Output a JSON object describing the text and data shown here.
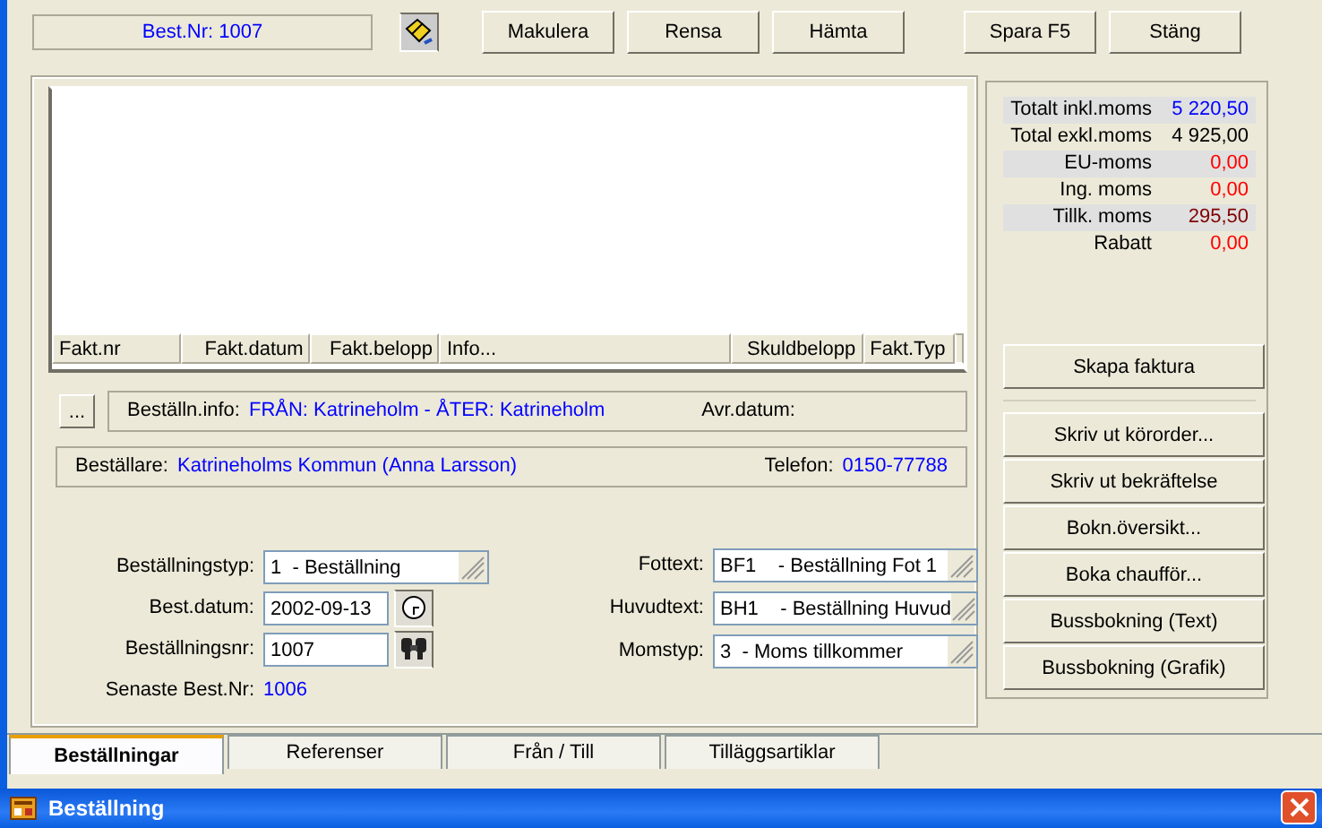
{
  "window": {
    "title": "Beställning"
  },
  "tabs": [
    {
      "label": "Beställningar",
      "selected": true
    },
    {
      "label": "Referenser",
      "selected": false
    },
    {
      "label": "Från / Till",
      "selected": false
    },
    {
      "label": "Tilläggsartiklar",
      "selected": false
    }
  ],
  "toolbar": {
    "order_number": "Best.Nr: 1007",
    "buttons": [
      "Makulera",
      "Rensa",
      "Hämta",
      "Spara F5",
      "Stäng"
    ]
  },
  "invoice_table": {
    "columns": [
      "Fakt.nr",
      "Fakt.datum",
      "Fakt.belopp",
      "Info...",
      "Skuldbelopp",
      "Fakt.Typ"
    ]
  },
  "order_info": {
    "button": "...",
    "label": "Beställn.info:",
    "value": "FRÅN: Katrineholm - ÅTER: Katrineholm",
    "return_date_label": "Avr.datum:"
  },
  "customer": {
    "label": "Beställare:",
    "value": "Katrineholms Kommun (Anna Larsson)",
    "phone_label": "Telefon:",
    "phone": "0150-77788"
  },
  "latest_order": {
    "label": "Senaste Best.Nr:",
    "value": "1006"
  },
  "fields_left": [
    {
      "label": "Beställningstyp:",
      "value": "1  - Beställning",
      "kind": "dropdown"
    },
    {
      "label": "Best.datum:",
      "value": "2002-09-13",
      "kind": "date"
    },
    {
      "label": "Beställningsnr:",
      "value": "1007",
      "kind": "search"
    }
  ],
  "fields_right": [
    {
      "label": "Fottext:",
      "value": "BF1    - Beställning Fot 1",
      "kind": "dropdown"
    },
    {
      "label": "Huvudtext:",
      "value": "BH1    - Beställning Huvud",
      "kind": "dropdown"
    },
    {
      "label": "Momstyp:",
      "value": "3  - Moms tillkommer",
      "kind": "dropdown"
    }
  ],
  "actions": [
    "Skriv ut körorder...",
    "Skriv ut bekräftelse",
    "Bokn.översikt...",
    "Boka chaufför...",
    "Bussbokning (Text)",
    "Bussbokning (Grafik)"
  ],
  "create_invoice": "Skapa faktura",
  "totals": [
    {
      "label": "Totalt inkl.moms",
      "value": "5 220,50",
      "color": "#0000ff"
    },
    {
      "label": "Total exkl.moms",
      "value": "4 925,00",
      "color": "#000000"
    },
    {
      "label": "EU-moms",
      "value": "0,00",
      "color": "#ff0000"
    },
    {
      "label": "Ing. moms",
      "value": "0,00",
      "color": "#ff0000"
    },
    {
      "label": "Tillk. moms",
      "value": "295,50",
      "color": "#800000"
    },
    {
      "label": "Rabatt",
      "value": "0,00",
      "color": "#ff0000"
    }
  ]
}
